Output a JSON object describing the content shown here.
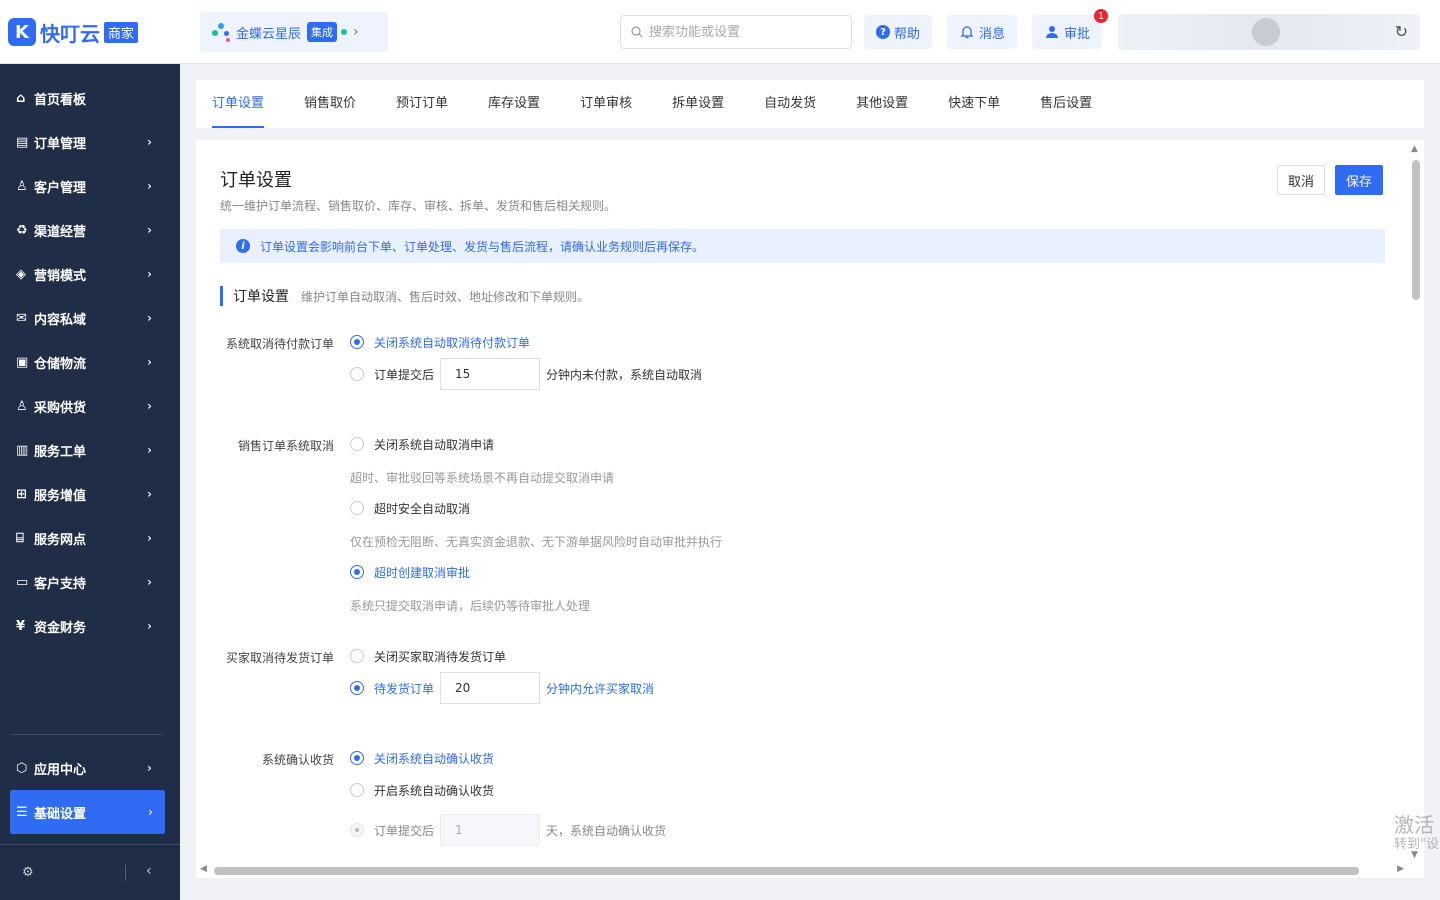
{
  "header": {
    "logo_text": "快叮云",
    "logo_tag": "商家",
    "tenant_name": "金蝶云星辰",
    "tenant_tag": "集成",
    "search_placeholder": "搜索功能或设置",
    "help_label": "帮助",
    "messages_label": "消息",
    "approval_label": "审批",
    "approval_badge": "1"
  },
  "sidebar": {
    "items": [
      {
        "label": "首页看板",
        "icon": "home-icon"
      },
      {
        "label": "订单管理",
        "icon": "clipboard-icon"
      },
      {
        "label": "客户管理",
        "icon": "user-icon"
      },
      {
        "label": "渠道经营",
        "icon": "recycle-icon"
      },
      {
        "label": "营销模式",
        "icon": "tag-icon"
      },
      {
        "label": "内容私域",
        "icon": "mail-icon"
      },
      {
        "label": "仓储物流",
        "icon": "box-icon"
      },
      {
        "label": "采购供货",
        "icon": "person-icon"
      },
      {
        "label": "服务工单",
        "icon": "ticket-icon"
      },
      {
        "label": "服务增值",
        "icon": "gift-icon"
      },
      {
        "label": "服务网点",
        "icon": "store-icon"
      },
      {
        "label": "客户支持",
        "icon": "chat-icon"
      },
      {
        "label": "资金财务",
        "icon": "yen-icon"
      }
    ],
    "bottom": [
      {
        "label": "应用中心",
        "icon": "cube-icon"
      },
      {
        "label": "基础设置",
        "icon": "sliders-icon"
      }
    ]
  },
  "tabs": [
    "订单设置",
    "销售取价",
    "预订订单",
    "库存设置",
    "订单审核",
    "拆单设置",
    "自动发货",
    "其他设置",
    "快速下单",
    "售后设置"
  ],
  "page": {
    "title": "订单设置",
    "desc": "统一维护订单流程、销售取价、库存、审核、拆单、发货和售后相关规则。",
    "cancel_label": "取消",
    "save_label": "保存",
    "notice": "订单设置会影响前台下单、订单处理、发货与售后流程，请确认业务规则后再保存。",
    "section_title": "订单设置",
    "section_desc": "维护订单自动取消、售后时效、地址修改和下单规则。"
  },
  "settings": {
    "unpaid_cancel": {
      "label": "系统取消待付款订单",
      "opt1": "关闭系统自动取消待付款订单",
      "opt2_prefix": "订单提交后",
      "opt2_value": "15",
      "opt2_suffix": "分钟内未付款，系统自动取消"
    },
    "sales_cancel": {
      "label": "销售订单系统取消",
      "opt1": "关闭系统自动取消申请",
      "opt1_hint": "超时、审批驳回等系统场景不再自动提交取消申请",
      "opt2": "超时安全自动取消",
      "opt2_hint": "仅在预检无阻断、无真实资金退款、无下游单据风险时自动审批并执行",
      "opt3": "超时创建取消审批",
      "opt3_hint": "系统只提交取消申请，后续仍等待审批人处理"
    },
    "buyer_cancel": {
      "label": "买家取消待发货订单",
      "opt1": "关闭买家取消待发货订单",
      "opt2_prefix": "待发货订单",
      "opt2_value": "20",
      "opt2_suffix": "分钟内允许买家取消"
    },
    "confirm_receipt": {
      "label": "系统确认收货",
      "opt1": "关闭系统自动确认收货",
      "opt2": "开启系统自动确认收货",
      "opt3_prefix": "订单提交后",
      "opt3_value": "1",
      "opt3_suffix": "天，系统自动确认收货"
    }
  },
  "watermark": {
    "line1": "激活",
    "line2": "转到\"设"
  }
}
